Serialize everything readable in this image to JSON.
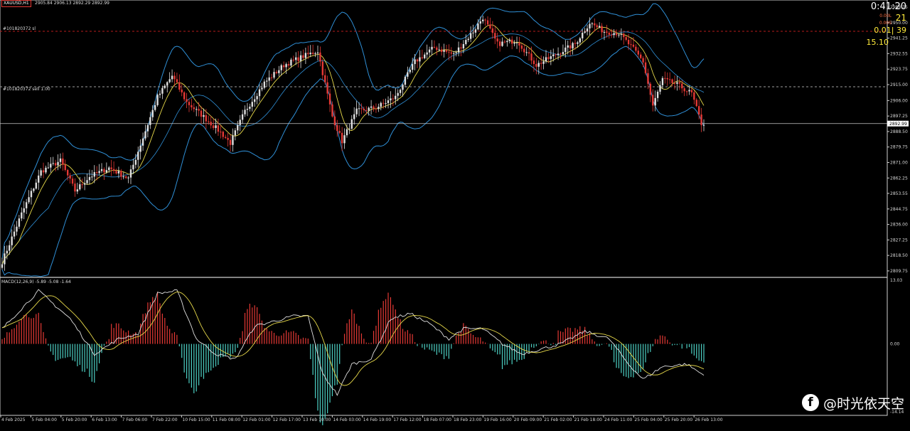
{
  "header": {
    "symbol": "XAUUSD,H1",
    "ohlc": "2905.84 2906.13 2892.29 2892.99",
    "macd_label": "MACD(12,26,9) -5.89 -5.08 -1.64"
  },
  "levels": [
    {
      "label": "#101820372 sl",
      "price": 2945.1,
      "color": "#b71c1c"
    },
    {
      "label": "#101820372 sell 1.00",
      "price": 2913.8,
      "color": "#9e9e9e"
    }
  ],
  "current_price": {
    "value": 2892.99,
    "label": "2892.99"
  },
  "info_panel": {
    "timer": "0:41:20",
    "big1": "21",
    "small1": "0.00L",
    "small2": "0.00S",
    "ratio": "0.01| 39",
    "spread": "15.10",
    "colors": {
      "timer": "#ffffff",
      "big": "#ffeb3b",
      "small": "#ff7043"
    }
  },
  "watermark": "@时光依天空",
  "chart_data": [
    {
      "type": "candlestick",
      "title": "XAUUSD,H1",
      "ylim": [
        2806.5,
        2962.0
      ],
      "y_ticks": [
        2958.75,
        2950.0,
        2941.25,
        2932.55,
        2923.75,
        2915.0,
        2906.0,
        2897.25,
        2888.5,
        2879.75,
        2871.0,
        2862.25,
        2853.55,
        2844.75,
        2836.0,
        2827.25,
        2818.5,
        2809.75
      ],
      "y_tick_labels": [
        "2958.75",
        "2950.00",
        "2941.25",
        "2932.55",
        "2923.75",
        "2915.00",
        "2906.00",
        "2897.25",
        "2888.50",
        "2879.75",
        "2871.00",
        "2862.25",
        "2853.55",
        "2844.75",
        "2836.00",
        "2827.25",
        "2818.50",
        "2809.75"
      ],
      "x_labels": [
        "4 Feb 2025",
        "5 Feb 04:00",
        "5 Feb 20:00",
        "6 Feb 13:00",
        "7 Feb 06:00",
        "7 Feb 22:00",
        "10 Feb 15:00",
        "11 Feb 08:00",
        "12 Feb 01:00",
        "12 Feb 17:00",
        "13 Feb 10:00",
        "14 Feb 03:00",
        "14 Feb 19:00",
        "17 Feb 12:00",
        "18 Feb 07:00",
        "18 Feb 23:00",
        "19 Feb 16:00",
        "20 Feb 09:00",
        "21 Feb 02:00",
        "21 Feb 18:00",
        "24 Feb 11:00",
        "25 Feb 04:00",
        "25 Feb 20:00",
        "26 Feb 13:00"
      ],
      "key_closes": [
        [
          0,
          2815
        ],
        [
          8,
          2842
        ],
        [
          16,
          2866
        ],
        [
          24,
          2872
        ],
        [
          30,
          2855
        ],
        [
          36,
          2863
        ],
        [
          44,
          2868
        ],
        [
          52,
          2862
        ],
        [
          58,
          2885
        ],
        [
          64,
          2908
        ],
        [
          70,
          2920
        ],
        [
          76,
          2905
        ],
        [
          82,
          2898
        ],
        [
          90,
          2888
        ],
        [
          94,
          2882
        ],
        [
          100,
          2900
        ],
        [
          108,
          2916
        ],
        [
          116,
          2926
        ],
        [
          124,
          2931
        ],
        [
          130,
          2934
        ],
        [
          136,
          2897
        ],
        [
          140,
          2883
        ],
        [
          146,
          2900
        ],
        [
          154,
          2902
        ],
        [
          162,
          2908
        ],
        [
          170,
          2928
        ],
        [
          178,
          2936
        ],
        [
          186,
          2932
        ],
        [
          194,
          2945
        ],
        [
          198,
          2953
        ],
        [
          204,
          2938
        ],
        [
          212,
          2940
        ],
        [
          220,
          2926
        ],
        [
          228,
          2932
        ],
        [
          236,
          2938
        ],
        [
          242,
          2950
        ],
        [
          248,
          2945
        ],
        [
          254,
          2944
        ],
        [
          260,
          2935
        ],
        [
          264,
          2928
        ],
        [
          268,
          2903
        ],
        [
          272,
          2918
        ],
        [
          278,
          2915
        ],
        [
          284,
          2910
        ],
        [
          288,
          2893
        ]
      ],
      "colors": {
        "up": "#e0e0e0",
        "down": "#e53935",
        "bands": "#2f8fd6",
        "ma": "#e6d84a"
      },
      "grid": false
    },
    {
      "type": "bar",
      "title": "MACD(12,26,9) -5.89 -5.08 -1.64",
      "ylim": [
        -14.14,
        13.03
      ],
      "y_tick_labels": [
        "13.03",
        "0.00",
        "-14.14"
      ],
      "key_macd": [
        [
          0,
          3
        ],
        [
          15,
          10.5
        ],
        [
          28,
          5
        ],
        [
          38,
          -2
        ],
        [
          48,
          1
        ],
        [
          56,
          2
        ],
        [
          64,
          10
        ],
        [
          72,
          10.5
        ],
        [
          80,
          1
        ],
        [
          88,
          -2
        ],
        [
          96,
          -3
        ],
        [
          104,
          3.5
        ],
        [
          112,
          4.5
        ],
        [
          120,
          5.5
        ],
        [
          126,
          5.5
        ],
        [
          132,
          -6
        ],
        [
          138,
          -10
        ],
        [
          144,
          -4
        ],
        [
          152,
          -3
        ],
        [
          160,
          5
        ],
        [
          168,
          6
        ],
        [
          176,
          4
        ],
        [
          184,
          1
        ],
        [
          190,
          3
        ],
        [
          198,
          3
        ],
        [
          206,
          0
        ],
        [
          214,
          -2
        ],
        [
          222,
          -1
        ],
        [
          230,
          0
        ],
        [
          240,
          2.5
        ],
        [
          250,
          1
        ],
        [
          258,
          -4
        ],
        [
          264,
          -7
        ],
        [
          272,
          -4.5
        ],
        [
          282,
          -4
        ],
        [
          288,
          -5.9
        ]
      ],
      "colors": {
        "hist_pos": "#e53935",
        "hist_neg": "#4dd0c4",
        "macd": "#e0e0e0",
        "signal": "#e6d84a"
      },
      "grid": false
    }
  ]
}
